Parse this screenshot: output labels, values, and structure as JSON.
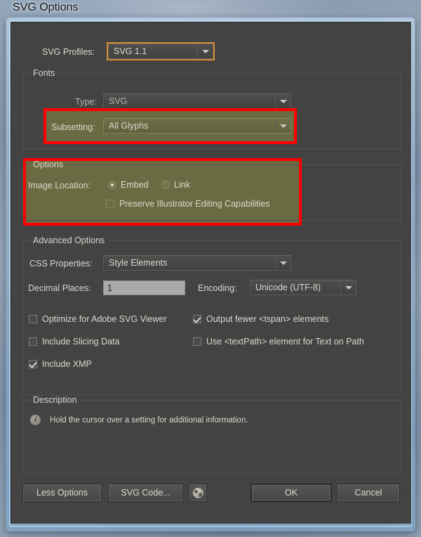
{
  "window": {
    "title": "SVG Options"
  },
  "top": {
    "svg_profiles_label": "SVG Profiles:",
    "svg_profiles_value": "SVG 1.1"
  },
  "fonts_group": {
    "title": "Fonts",
    "type_label": "Type:",
    "type_value": "SVG",
    "subsetting_label": "Subsetting:",
    "subsetting_value": "All Glyphs"
  },
  "options_group": {
    "title": "Options",
    "image_location_label": "Image Location:",
    "embed_label": "Embed",
    "link_label": "Link",
    "preserve_label": "Preserve Illustrator Editing Capabilities",
    "embed_selected": true,
    "link_selected": false,
    "preserve_checked": false
  },
  "advanced_group": {
    "title": "Advanced Options",
    "css_properties_label": "CSS Properties:",
    "css_properties_value": "Style Elements",
    "decimal_places_label": "Decimal Places:",
    "decimal_places_value": "1",
    "encoding_label": "Encoding:",
    "encoding_value": "Unicode (UTF-8)",
    "checkboxes": [
      {
        "label": "Optimize for Adobe SVG Viewer",
        "checked": false
      },
      {
        "label": "Output fewer <tspan> elements",
        "checked": true
      },
      {
        "label": "Include Slicing Data",
        "checked": false
      },
      {
        "label": "Use <textPath> element for Text on Path",
        "checked": false
      },
      {
        "label": "Include XMP",
        "checked": true
      }
    ]
  },
  "description_group": {
    "title": "Description",
    "info_icon": "info-icon",
    "text": "Hold the cursor over a setting for additional information."
  },
  "footer": {
    "less_options_label": "Less Options",
    "svg_code_label": "SVG Code...",
    "globe_icon": "globe-icon",
    "ok_label": "OK",
    "cancel_label": "Cancel"
  },
  "annotations": {
    "highlight_color": "#6b6b43",
    "outline_color": "#ff0000",
    "focus_color": "#d98f34"
  }
}
